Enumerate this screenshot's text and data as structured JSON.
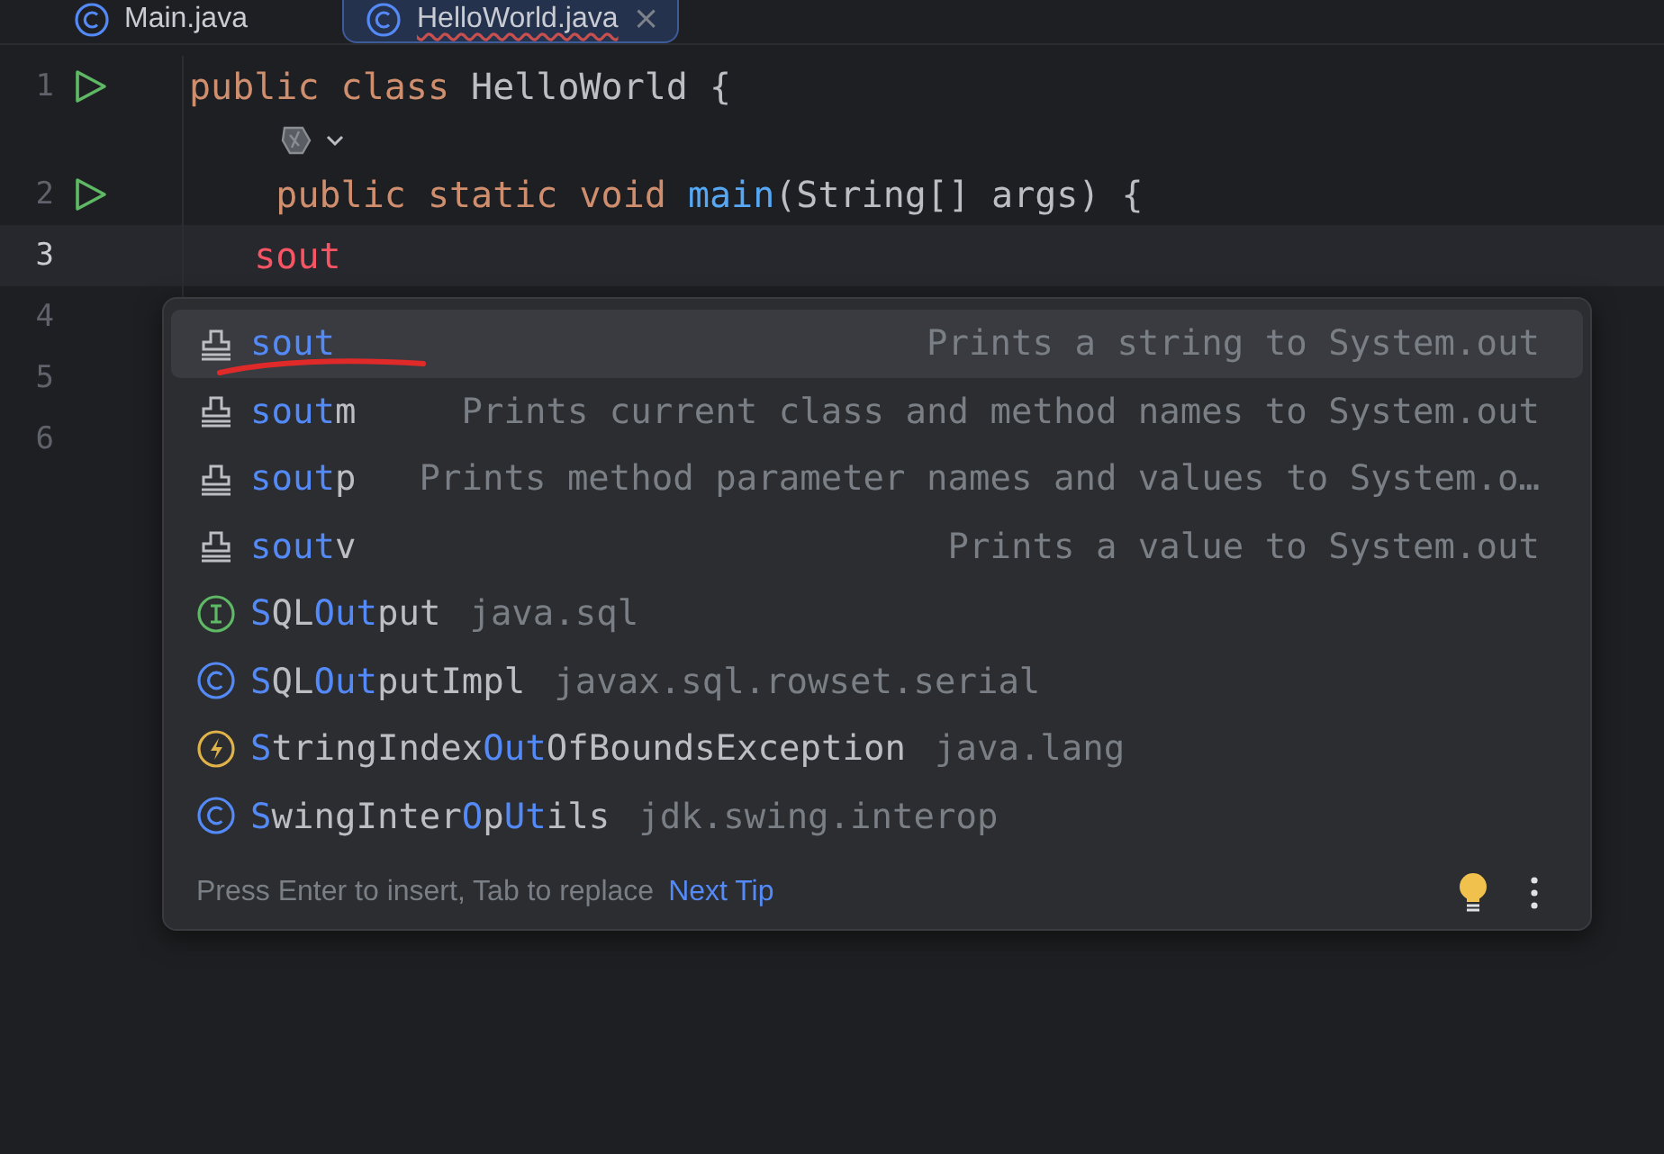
{
  "tabs": [
    {
      "label": "Main.java",
      "selected": false,
      "error": false
    },
    {
      "label": "HelloWorld.java",
      "selected": true,
      "error": true,
      "close": "×"
    }
  ],
  "editor": {
    "lines": [
      {
        "kind": "code",
        "number": "1",
        "runnable": true,
        "current": false,
        "tokens": [
          {
            "text": "public class ",
            "kind": "keyword"
          },
          {
            "text": "HelloWorld {",
            "kind": "plain"
          }
        ]
      },
      {
        "kind": "inlay"
      },
      {
        "kind": "code",
        "number": "2",
        "runnable": true,
        "current": false,
        "tokens": [
          {
            "text": "    public static void ",
            "kind": "keyword"
          },
          {
            "text": "main",
            "kind": "method"
          },
          {
            "text": "(String[] args) {",
            "kind": "plain"
          }
        ]
      },
      {
        "kind": "code",
        "number": "3",
        "current": true,
        "tokens": [
          {
            "text": "   sout",
            "kind": "error"
          }
        ]
      },
      {
        "kind": "code",
        "number": "4",
        "current": false
      },
      {
        "kind": "code",
        "number": "5",
        "current": false
      },
      {
        "kind": "code",
        "number": "6",
        "current": false
      }
    ]
  },
  "completion": {
    "items": [
      {
        "kind": "template",
        "parts": [
          {
            "text": "sout",
            "match": true
          }
        ],
        "detail": "Prints a string to System.out",
        "selected": true,
        "underlined": true
      },
      {
        "kind": "template",
        "parts": [
          {
            "text": "sout",
            "match": true
          },
          {
            "text": "m",
            "match": false
          }
        ],
        "detail": "Prints current class and method names to System.out",
        "selected": false
      },
      {
        "kind": "template",
        "parts": [
          {
            "text": "sout",
            "match": true
          },
          {
            "text": "p",
            "match": false
          }
        ],
        "detail": "Prints method parameter names and values to System.o…",
        "selected": false
      },
      {
        "kind": "template",
        "parts": [
          {
            "text": "sout",
            "match": true
          },
          {
            "text": "v",
            "match": false
          }
        ],
        "detail": "Prints a value to System.out",
        "selected": false
      },
      {
        "kind": "interface",
        "parts": [
          {
            "text": "S",
            "match": true
          },
          {
            "text": "QL",
            "match": false
          },
          {
            "text": "Out",
            "match": true
          },
          {
            "text": "put",
            "match": false
          }
        ],
        "detail": "java.sql",
        "selected": false
      },
      {
        "kind": "class",
        "parts": [
          {
            "text": "S",
            "match": true
          },
          {
            "text": "QL",
            "match": false
          },
          {
            "text": "Out",
            "match": true
          },
          {
            "text": "putImpl",
            "match": false
          }
        ],
        "detail": "javax.sql.rowset.serial",
        "selected": false
      },
      {
        "kind": "exception",
        "parts": [
          {
            "text": "S",
            "match": true
          },
          {
            "text": "tringIndex",
            "match": false
          },
          {
            "text": "Out",
            "match": true
          },
          {
            "text": "OfBoundsException",
            "match": false
          }
        ],
        "detail": "java.lang",
        "selected": false
      },
      {
        "kind": "class",
        "parts": [
          {
            "text": "S",
            "match": true
          },
          {
            "text": "wingInter",
            "match": false
          },
          {
            "text": "O",
            "match": true
          },
          {
            "text": "p",
            "match": false
          },
          {
            "text": "Ut",
            "match": true
          },
          {
            "text": "ils",
            "match": false
          }
        ],
        "detail": "jdk.swing.interop",
        "selected": false
      }
    ],
    "footer": {
      "hint": "Press Enter to insert, Tab to replace",
      "link": "Next Tip"
    }
  }
}
